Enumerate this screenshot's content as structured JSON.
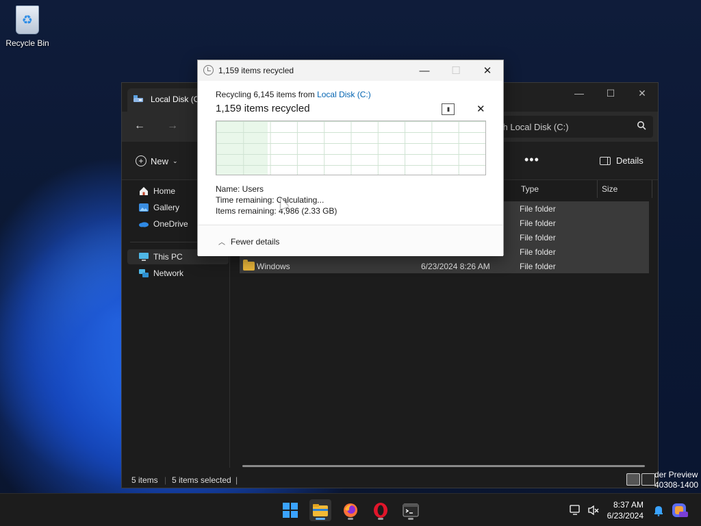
{
  "desktop": {
    "recycle_bin_label": "Recycle Bin",
    "watermark_line1": "der Preview",
    "watermark_line2": "40308-1400"
  },
  "explorer": {
    "tab_title": "Local Disk (C",
    "search_placeholder": "ch Local Disk (C:)",
    "new_label": "New",
    "more_label": "•••",
    "details_label": "Details",
    "sidebar": [
      {
        "label": "Home",
        "icon": "home-icon"
      },
      {
        "label": "Gallery",
        "icon": "gallery-icon"
      },
      {
        "label": "OneDrive",
        "icon": "onedrive-icon"
      },
      {
        "label": "This PC",
        "icon": "this-pc-icon"
      },
      {
        "label": "Network",
        "icon": "network-icon"
      }
    ],
    "columns": {
      "type": "Type",
      "size": "Size"
    },
    "rows": [
      {
        "name": "",
        "date": "",
        "type": "File folder"
      },
      {
        "name": "",
        "date": "",
        "type": "File folder"
      },
      {
        "name": "",
        "date": "",
        "type": "File folder"
      },
      {
        "name": "",
        "date": "",
        "type": "File folder"
      },
      {
        "name": "Windows",
        "date": "6/23/2024 8:26 AM",
        "type": "File folder"
      }
    ],
    "status_items": "5 items",
    "status_selected": "5 items selected",
    "status_sep": "|"
  },
  "dialog": {
    "title": "1,159 items recycled",
    "source_prefix": "Recycling 6,145 items from",
    "source_link": "Local Disk (C:)",
    "progress_title": "1,159 items recycled",
    "progress_fraction": 0.19,
    "name_line": "Name:  Users",
    "time_line": "Time remaining:  Calculating...",
    "items_line": "Items remaining:  4,986 (2.33 GB)",
    "fewer_details": "Fewer details",
    "pause_glyph": "II",
    "cancel_glyph": "✕",
    "minimize_glyph": "—",
    "maximize_glyph": "☐",
    "close_glyph": "✕"
  },
  "taskbar": {
    "time": "8:37 AM",
    "date": "6/23/2024",
    "apps": [
      "start-icon",
      "file-explorer-icon",
      "firefox-icon",
      "opera-icon",
      "terminal-icon"
    ]
  },
  "colors": {
    "accent": "#0063b1",
    "progress_fill": "#e9f7ea",
    "folder": "#e8b53a"
  }
}
